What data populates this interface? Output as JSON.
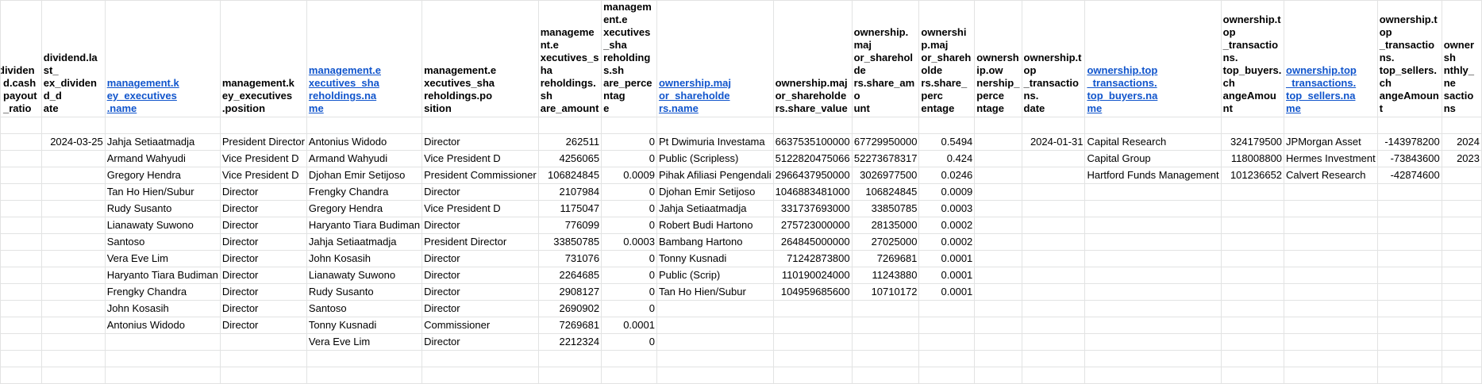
{
  "columns": [
    {
      "key": "payout",
      "header": "dividend.cashPayout_ratio_display",
      "label": "dividend.cash\npayout_ratio",
      "link": false
    },
    {
      "key": "lastex",
      "label": "dividend.last_ex_dividend_date",
      "link": false
    },
    {
      "key": "exname",
      "label": "management.key_executives.name",
      "link": true
    },
    {
      "key": "expos",
      "label": "management.key_executives.position",
      "link": false
    },
    {
      "key": "shname",
      "label": "management.executives_shareholdings.name",
      "link": true
    },
    {
      "key": "shpos",
      "label": "management.executives_shareholdings.position",
      "link": false
    },
    {
      "key": "shamt",
      "label": "management.executives_shareholdings.share_amount",
      "link": false
    },
    {
      "key": "shpct",
      "label": "management.executives_shareholdings.share_percentage",
      "link": false
    },
    {
      "key": "mjname",
      "label": "ownership.major_shareholders.name",
      "link": true
    },
    {
      "key": "mjval",
      "label": "ownership.major_shareholders.share_value",
      "link": false
    },
    {
      "key": "mjamt",
      "label": "ownership.major_shareholders.share_amount",
      "link": false
    },
    {
      "key": "mjpct",
      "label": "ownership.major_shareholders.share_percentage",
      "link": false
    },
    {
      "key": "owpct",
      "label": "ownership.ownership_percentage",
      "link": false
    },
    {
      "key": "ttdate",
      "label": "ownership.top_transactions.date",
      "link": false
    },
    {
      "key": "tbname",
      "label": "ownership.top_transactions.top_buyers.name",
      "link": true
    },
    {
      "key": "tbchg",
      "label": "ownership.top_transactions.top_buyers.changeAmount",
      "link": false
    },
    {
      "key": "tsname",
      "label": "ownership.top_transactions.top_sellers.name",
      "link": true
    },
    {
      "key": "tschg",
      "label": "ownership.top_transactions.top_sellers.changeAmount",
      "link": false
    },
    {
      "key": "monthly",
      "label": "ownership.monthly_net_transactions",
      "link": false
    }
  ],
  "header_display": [
    "dividend.cash\npayout_ratio",
    "dividend.last_\nex_dividend_d\nate",
    "management.k\ney_executives\n.name",
    "management.k\ney_executives\n.position",
    "management.e\nxecutives_sha\nreholdings.na\nme",
    "management.e\nxecutives_sha\nreholdings.po\nsition",
    "management.e\nxecutives_sha\nreholdings.sh\nare_amount",
    "management.e\nxecutives_sha\nreholdings.sh\nare_percentag\ne",
    "ownership.maj\nor_shareholde\nrs.name",
    "ownership.maj\nor_shareholde\nrs.share_value",
    "ownership.maj\nor_shareholde\nrs.share_amo\nunt",
    "ownership.maj\nor_shareholde\nrs.share_perc\nentage",
    "ownership.ow\nnership_perce\nntage",
    "ownership.top\n_transactions.\ndate",
    "ownership.top\n_transactions.\ntop_buyers.na\nme",
    "ownership.top\n_transactions.\ntop_buyers.ch\nangeAmount",
    "ownership.top\n_transactions.\ntop_sellers.na\nme",
    "ownership.top\n_transactions.\ntop_sellers.ch\nangeAmount",
    "ownersh\nnthly_ne\nsactions"
  ],
  "rows": [
    [
      "",
      "",
      "",
      "",
      "",
      "",
      "",
      "",
      "",
      "",
      "",
      "",
      "",
      "",
      "",
      "",
      "",
      "",
      ""
    ],
    [
      "",
      "2024-03-25",
      "Jahja Setiaatmadja",
      "President Director",
      "Antonius Widodo",
      "Director",
      "262511",
      "0",
      "Pt Dwimuria Investama",
      "6637535100000",
      "67729950000",
      "0.5494",
      "",
      "2024-01-31",
      "Capital Research",
      "324179500",
      "JPMorgan Asset",
      "-143978200",
      "2024"
    ],
    [
      "",
      "",
      "Armand Wahyudi",
      "Vice President D",
      "Armand Wahyudi",
      "Vice President D",
      "4256065",
      "0",
      "Public (Scripless)",
      "5122820475066",
      "52273678317",
      "0.424",
      "",
      "",
      "Capital Group",
      "118008800",
      "Hermes Investment",
      "-73843600",
      "2023"
    ],
    [
      "",
      "",
      "Gregory Hendra",
      "Vice President D",
      "Djohan Emir Setijoso",
      "President Commissioner",
      "106824845",
      "0.0009",
      "Pihak Afiliasi Pengendali",
      "2966437950000",
      "3026977500",
      "0.0246",
      "",
      "",
      "Hartford Funds Management",
      "101236652",
      "Calvert Research",
      "-42874600",
      ""
    ],
    [
      "",
      "",
      "Tan Ho Hien/Subur",
      "Director",
      "Frengky Chandra",
      "Director",
      "2107984",
      "0",
      "Djohan Emir Setijoso",
      "1046883481000",
      "106824845",
      "0.0009",
      "",
      "",
      "",
      "",
      "",
      "",
      ""
    ],
    [
      "",
      "",
      "Rudy Susanto",
      "Director",
      "Gregory Hendra",
      "Vice President D",
      "1175047",
      "0",
      "Jahja Setiaatmadja",
      "331737693000",
      "33850785",
      "0.0003",
      "",
      "",
      "",
      "",
      "",
      "",
      ""
    ],
    [
      "",
      "",
      "Lianawaty Suwono",
      "Director",
      "Haryanto Tiara Budiman",
      "Director",
      "776099",
      "0",
      "Robert Budi Hartono",
      "275723000000",
      "28135000",
      "0.0002",
      "",
      "",
      "",
      "",
      "",
      "",
      ""
    ],
    [
      "",
      "",
      "Santoso",
      "Director",
      "Jahja Setiaatmadja",
      "President Director",
      "33850785",
      "0.0003",
      "Bambang Hartono",
      "264845000000",
      "27025000",
      "0.0002",
      "",
      "",
      "",
      "",
      "",
      "",
      ""
    ],
    [
      "",
      "",
      "Vera Eve Lim",
      "Director",
      "John Kosasih",
      "Director",
      "731076",
      "0",
      "Tonny Kusnadi",
      "71242873800",
      "7269681",
      "0.0001",
      "",
      "",
      "",
      "",
      "",
      "",
      ""
    ],
    [
      "",
      "",
      "Haryanto Tiara Budiman",
      "Director",
      "Lianawaty Suwono",
      "Director",
      "2264685",
      "0",
      "Public (Scrip)",
      "110190024000",
      "11243880",
      "0.0001",
      "",
      "",
      "",
      "",
      "",
      "",
      ""
    ],
    [
      "",
      "",
      "Frengky Chandra",
      "Director",
      "Rudy Susanto",
      "Director",
      "2908127",
      "0",
      "Tan Ho Hien/Subur",
      "104959685600",
      "10710172",
      "0.0001",
      "",
      "",
      "",
      "",
      "",
      "",
      ""
    ],
    [
      "",
      "",
      "John Kosasih",
      "Director",
      "Santoso",
      "Director",
      "2690902",
      "0",
      "",
      "",
      "",
      "",
      "",
      "",
      "",
      "",
      "",
      "",
      ""
    ],
    [
      "",
      "",
      "Antonius Widodo",
      "Director",
      "Tonny Kusnadi",
      "Commissioner",
      "7269681",
      "0.0001",
      "",
      "",
      "",
      "",
      "",
      "",
      "",
      "",
      "",
      "",
      ""
    ],
    [
      "",
      "",
      "",
      "",
      "Vera Eve Lim",
      "Director",
      "2212324",
      "0",
      "",
      "",
      "",
      "",
      "",
      "",
      "",
      "",
      "",
      "",
      ""
    ],
    [
      "",
      "",
      "",
      "",
      "",
      "",
      "",
      "",
      "",
      "",
      "",
      "",
      "",
      "",
      "",
      "",
      "",
      "",
      ""
    ],
    [
      "",
      "",
      "",
      "",
      "",
      "",
      "",
      "",
      "",
      "",
      "",
      "",
      "",
      "",
      "",
      "",
      "",
      "",
      ""
    ]
  ],
  "numeric_columns": [
    1,
    6,
    7,
    9,
    10,
    11,
    13,
    15,
    17,
    18
  ]
}
